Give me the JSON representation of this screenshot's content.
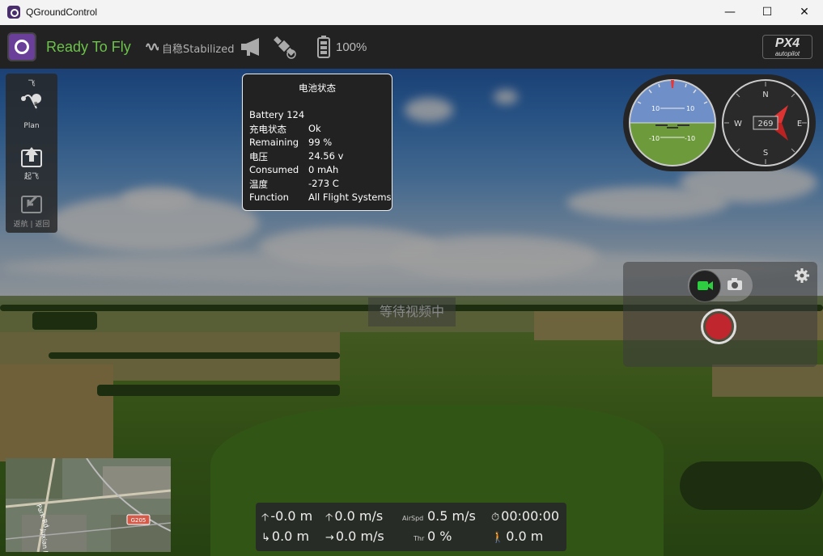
{
  "window": {
    "title": "QGroundControl",
    "controls": {
      "minimize": "—",
      "maximize": "☐",
      "close": "✕"
    }
  },
  "toolbar": {
    "status": "Ready To Fly",
    "flight_mode": "自稳Stabilized",
    "battery_percent": "100%",
    "brand_logo": "PX4",
    "brand_logo_sub": "autopilot"
  },
  "toolstrip": {
    "header": "飞",
    "items": [
      {
        "label": "Plan",
        "icon": "plan-icon"
      },
      {
        "label": "起飞",
        "icon": "takeoff-icon"
      },
      {
        "label": "返航 | 返回",
        "icon": "return-icon"
      }
    ]
  },
  "battery_popup": {
    "title": "电池状态",
    "name": "Battery 124",
    "rows": [
      {
        "key": "充电状态",
        "value": "Ok"
      },
      {
        "key": "Remaining",
        "value": "99 %"
      },
      {
        "key": "电压",
        "value": "24.56 v"
      },
      {
        "key": "Consumed",
        "value": "0 mAh"
      },
      {
        "key": "温度",
        "value": "-273 C"
      },
      {
        "key": "Function",
        "value": "All Flight Systems"
      }
    ]
  },
  "instruments": {
    "attitude_pitch_labels": [
      "10",
      "10",
      "-10",
      "-10"
    ],
    "compass": {
      "heading": "269",
      "n": "N",
      "e": "E",
      "s": "S",
      "w": "W"
    }
  },
  "video": {
    "waiting_text": "等待视频中"
  },
  "camera": {
    "mode": "video",
    "record_color": "#c0262d"
  },
  "map": {
    "road_label_1": "Park Rd",
    "road_label_2": "Juxian Rd",
    "road_badge": "G205"
  },
  "telemetry": {
    "altitude": "-0.0 m",
    "vertical_speed": "0.0 m/s",
    "airspeed_label": "AirSpd",
    "airspeed": "0.5 m/s",
    "flight_time": "00:00:00",
    "distance": "0.0 m",
    "ground_speed": "0.0 m/s",
    "throttle_label": "Thr",
    "throttle": "0 %",
    "distance_to_home": "0.0 m"
  },
  "colors": {
    "ready": "#6cc24a",
    "record": "#c0262d",
    "camera_active": "#2ecc40"
  }
}
